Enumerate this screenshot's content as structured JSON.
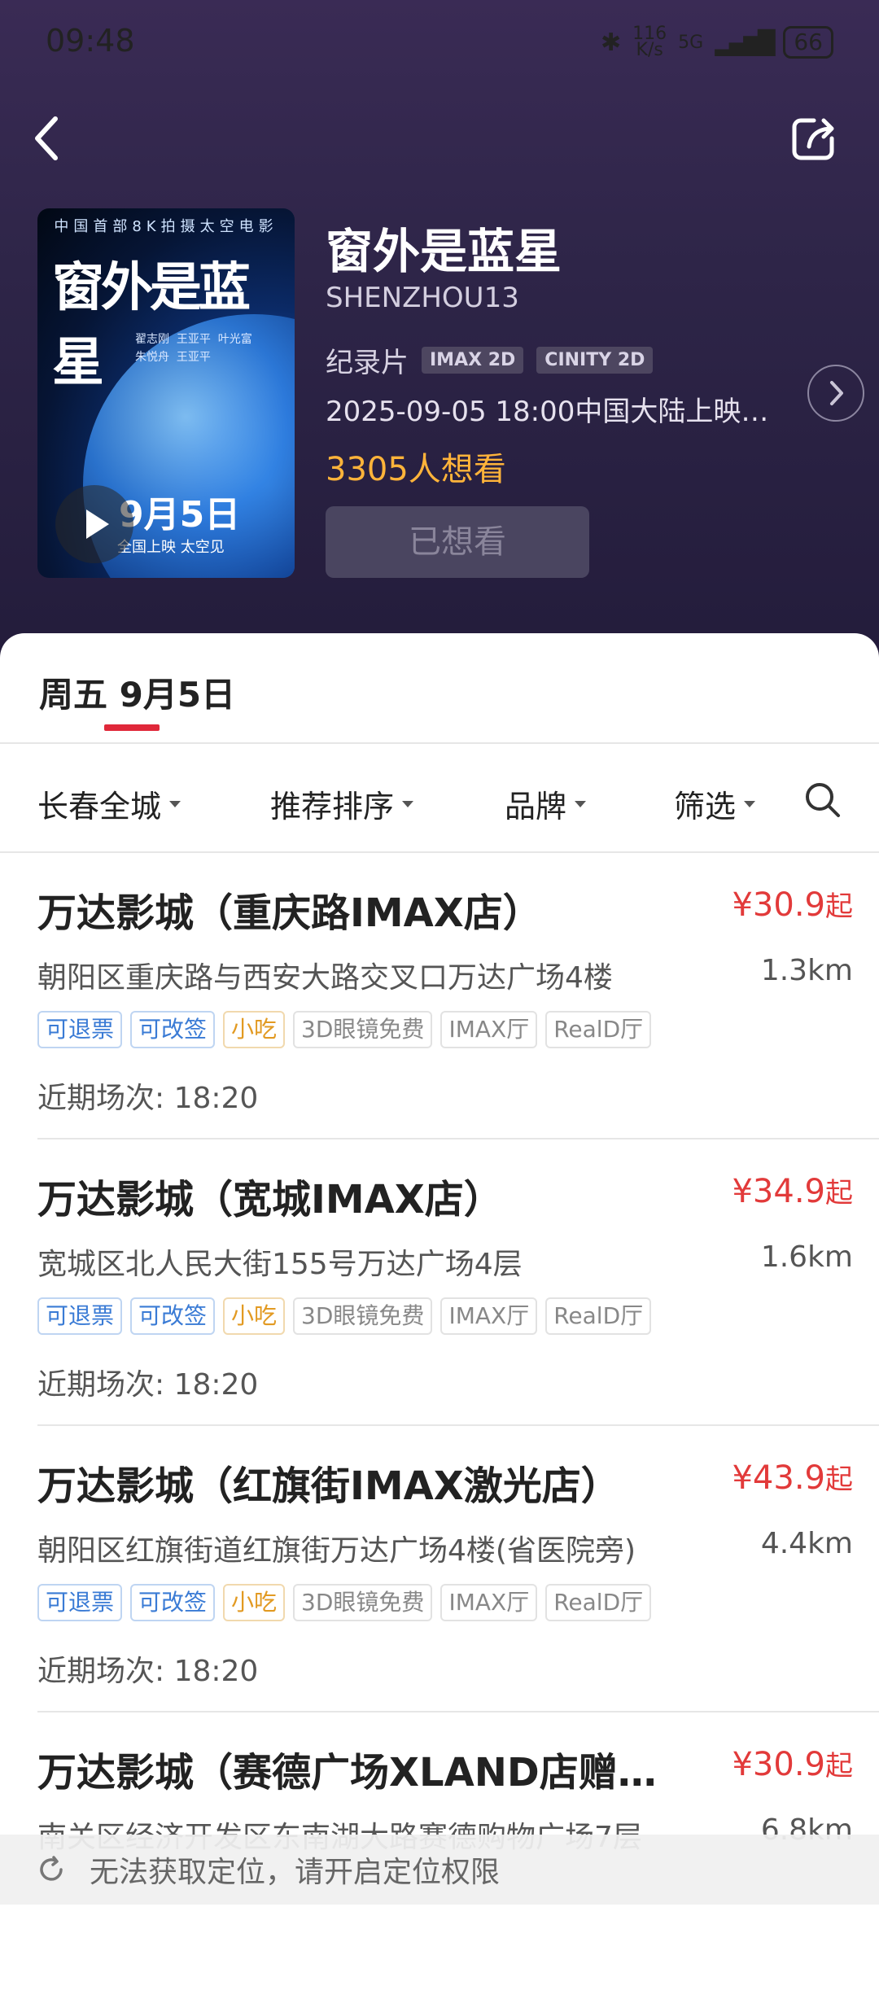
{
  "status": {
    "time": "09:48",
    "net": "116\nK/s",
    "battery": "66",
    "signal": "5G"
  },
  "movie": {
    "title": "窗外是蓝星",
    "english_title": "SHENZHOU13",
    "genre": "纪录片",
    "badges": [
      "IMAX 2D",
      "CINITY 2D"
    ],
    "release": "2025-09-05 18:00中国大陆上映…",
    "wish_count": "3305人想看",
    "wanted_button": "已想看",
    "poster": {
      "top_line": "中国首部8K拍摄太空电影",
      "title": "窗外是蓝星",
      "date": "9月5日",
      "tagline": "全国上映  太空见",
      "credits": "翟志刚  王亚平  叶光富\n朱悦舟  王亚平"
    }
  },
  "date_tab": "周五 9月5日",
  "filters": [
    "长春全城",
    "推荐排序",
    "品牌",
    "筛选"
  ],
  "cinemas": [
    {
      "name": "万达影城（重庆路IMAX店）",
      "price": "¥30.9",
      "price_suffix": "起",
      "address": "朝阳区重庆路与西安大路交叉口万达广场4楼",
      "distance": "1.3km",
      "recent": "近期场次: 18:20"
    },
    {
      "name": "万达影城（宽城IMAX店）",
      "price": "¥34.9",
      "price_suffix": "起",
      "address": "宽城区北人民大街155号万达广场4层",
      "distance": "1.6km",
      "recent": "近期场次: 18:20"
    },
    {
      "name": "万达影城（红旗街IMAX激光店）",
      "price": "¥43.9",
      "price_suffix": "起",
      "address": "朝阳区红旗街道红旗街万达广场4楼(省医院旁)",
      "distance": "4.4km",
      "recent": "近期场次: 18:20"
    },
    {
      "name": "万达影城（赛德广场XLAND店赠…",
      "price": "¥30.9",
      "price_suffix": "起",
      "address": "南关区经济开发区东南湖大路赛德购物广场7层",
      "distance": "6.8km",
      "recent": ""
    }
  ],
  "tags": [
    {
      "label": "可退票",
      "style": "blue"
    },
    {
      "label": "可改签",
      "style": "blue"
    },
    {
      "label": "小吃",
      "style": "orange"
    },
    {
      "label": "3D眼镜免费",
      "style": "gray"
    },
    {
      "label": "IMAX厅",
      "style": "gray"
    },
    {
      "label": "RealD厅",
      "style": "gray"
    }
  ],
  "toast": "无法获取定位，请开启定位权限",
  "colors": {
    "accent": "#e0283a",
    "price": "#e23a3a",
    "wish": "#ffb43a",
    "hero_bg": "#2e2548"
  }
}
